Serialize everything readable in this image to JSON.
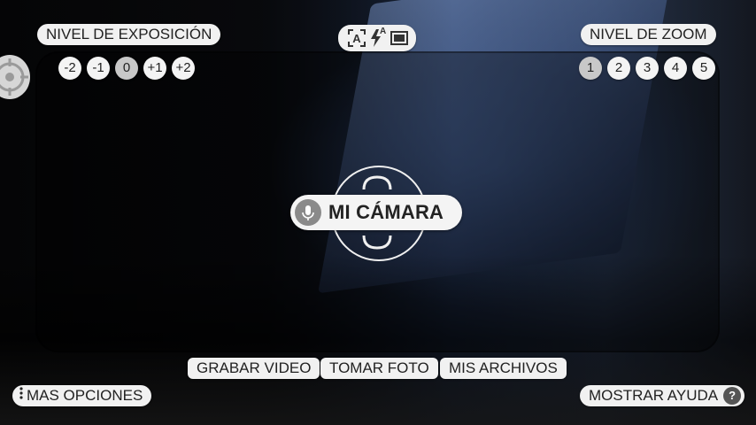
{
  "exposure": {
    "title": "NIVEL DE EXPOSICIÓN",
    "levels": [
      "-2",
      "-1",
      "0",
      "+1",
      "+2"
    ],
    "selected": "0"
  },
  "zoom": {
    "title": "NIVEL DE ZOOM",
    "levels": [
      "1",
      "2",
      "3",
      "4",
      "5"
    ],
    "selected": "1"
  },
  "mode_icons": [
    "auto-frame-icon",
    "flash-auto-icon",
    "aspect-ratio-icon"
  ],
  "mode_flash_sup": "A",
  "center": {
    "title": "MI CÁMARA",
    "mic_icon": "microphone-icon"
  },
  "actions": {
    "record": "GRABAR VIDEO",
    "photo": "TOMAR FOTO",
    "files": "MIS ARCHIVOS"
  },
  "bottom": {
    "more_options": "MAS OPCIONES",
    "help": "MOSTRAR AYUDA",
    "help_icon": "?"
  },
  "colors": {
    "pill_bg": "#f1f1f1",
    "active_level": "#c8c8c8"
  }
}
